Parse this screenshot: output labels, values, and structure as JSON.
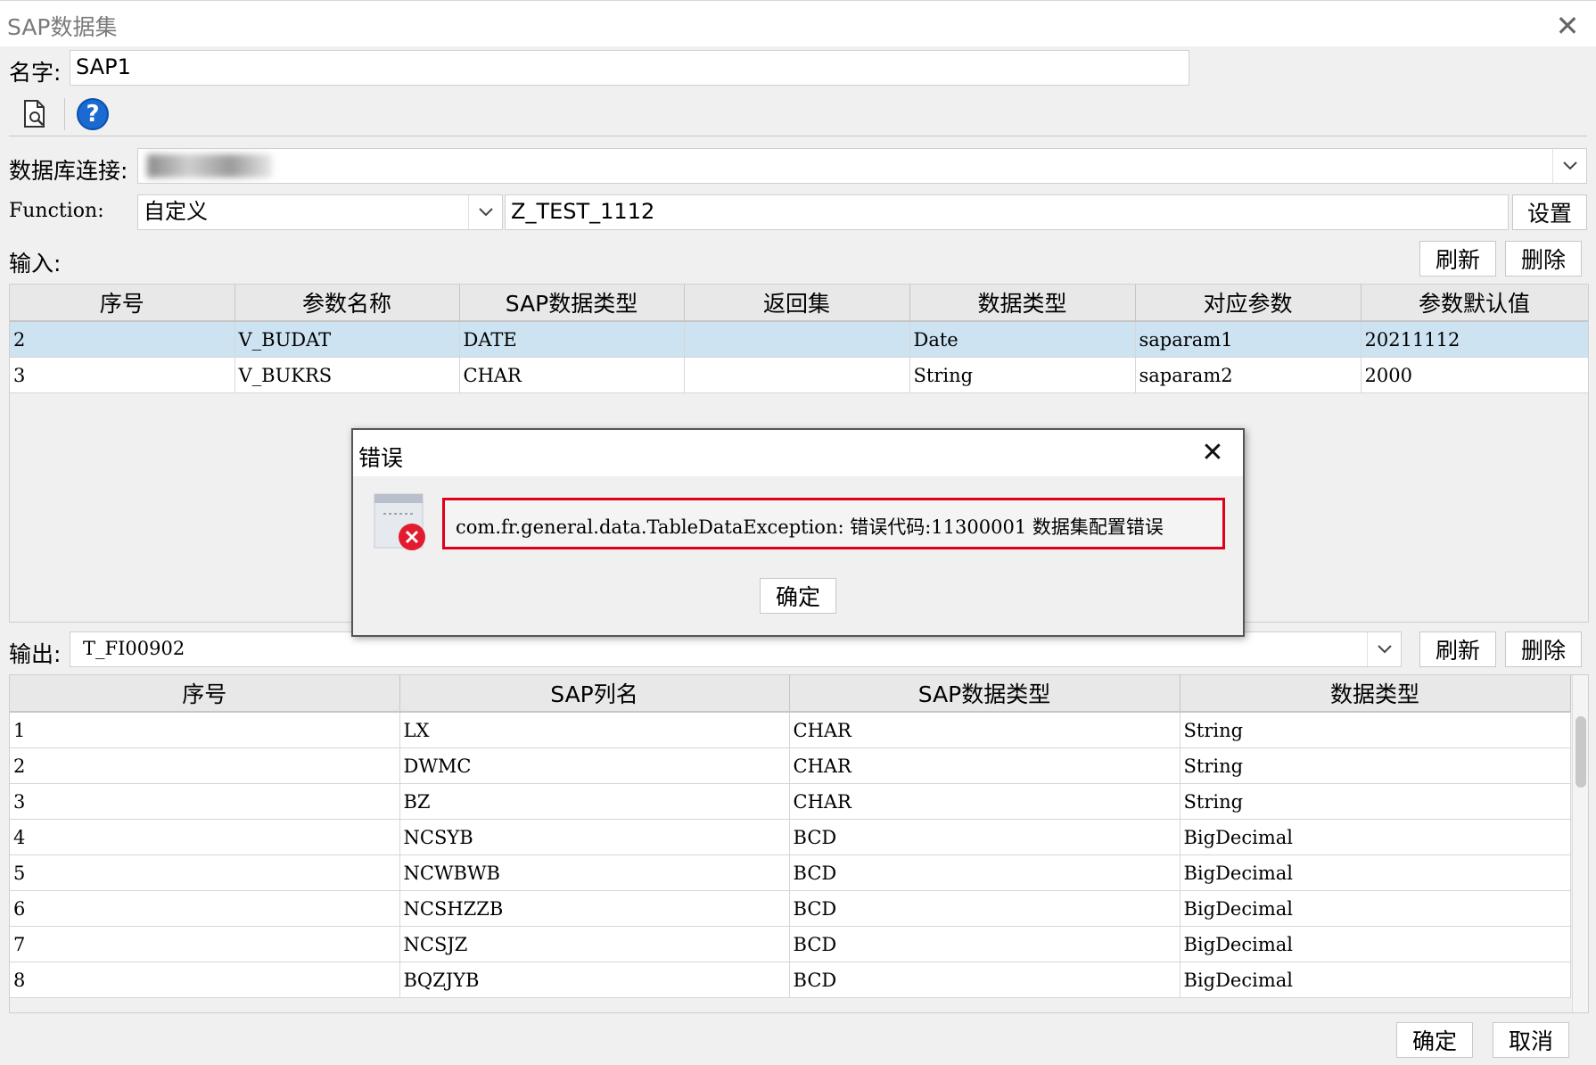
{
  "window": {
    "title": "SAP数据集",
    "close_glyph": "✕"
  },
  "name_row": {
    "label": "名字:",
    "value": "SAP1"
  },
  "toolbar": {
    "preview_icon": "preview-document-icon",
    "help_icon": "help-icon",
    "help_glyph": "?"
  },
  "db_row": {
    "label": "数据库连接:",
    "value": ""
  },
  "function_row": {
    "label": "Function:",
    "mode": "自定义",
    "value": "Z_TEST_1112",
    "settings_label": "设置"
  },
  "input_section": {
    "label": "输入:",
    "refresh_label": "刷新",
    "delete_label": "删除",
    "columns": [
      "序号",
      "参数名称",
      "SAP数据类型",
      "返回集",
      "数据类型",
      "对应参数",
      "参数默认值"
    ],
    "rows": [
      {
        "no": "2",
        "name": "V_BUDAT",
        "sap_type": "DATE",
        "return_set": "",
        "data_type": "Date",
        "param": "saparam1",
        "default": "20211112"
      },
      {
        "no": "3",
        "name": "V_BUKRS",
        "sap_type": "CHAR",
        "return_set": "",
        "data_type": "String",
        "param": "saparam2",
        "default": "2000"
      }
    ]
  },
  "output_section": {
    "label": "输出:",
    "value": "T_FI00902",
    "refresh_label": "刷新",
    "delete_label": "删除",
    "columns": [
      "序号",
      "SAP列名",
      "SAP数据类型",
      "数据类型"
    ],
    "rows": [
      {
        "no": "1",
        "col": "LX",
        "sap_type": "CHAR",
        "data_type": "String"
      },
      {
        "no": "2",
        "col": "DWMC",
        "sap_type": "CHAR",
        "data_type": "String"
      },
      {
        "no": "3",
        "col": "BZ",
        "sap_type": "CHAR",
        "data_type": "String"
      },
      {
        "no": "4",
        "col": "NCSYB",
        "sap_type": "BCD",
        "data_type": "BigDecimal"
      },
      {
        "no": "5",
        "col": "NCWBWB",
        "sap_type": "BCD",
        "data_type": "BigDecimal"
      },
      {
        "no": "6",
        "col": "NCSHZZB",
        "sap_type": "BCD",
        "data_type": "BigDecimal"
      },
      {
        "no": "7",
        "col": "NCSJZ",
        "sap_type": "BCD",
        "data_type": "BigDecimal"
      },
      {
        "no": "8",
        "col": "BQZJYB",
        "sap_type": "BCD",
        "data_type": "BigDecimal"
      }
    ]
  },
  "footer": {
    "ok_label": "确定",
    "cancel_label": "取消"
  },
  "error_dialog": {
    "title": "错误",
    "close_glyph": "✕",
    "message": "com.fr.general.data.TableDataException: 错误代码:11300001 数据集配置错误",
    "ok_label": "确定",
    "highlight_color": "#e0001b"
  }
}
